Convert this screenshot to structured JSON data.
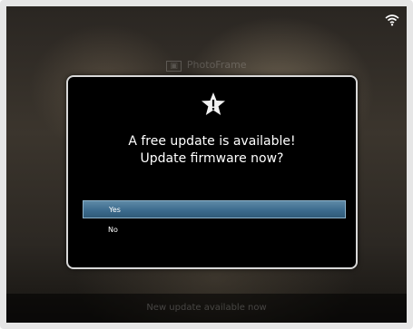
{
  "background": {
    "faint_title": "PhotoFrame",
    "footer_status": "New update available now"
  },
  "status_bar": {
    "wifi_icon": "wifi-icon"
  },
  "dialog": {
    "icon": "star-alert-icon",
    "message_line1": "A free update is available!",
    "message_line2": "Update firmware now?",
    "options": [
      {
        "label": "Yes",
        "selected": true
      },
      {
        "label": "No",
        "selected": false
      }
    ]
  },
  "colors": {
    "accent": "#3d6c8e",
    "dialog_border": "#d8d8d8"
  }
}
